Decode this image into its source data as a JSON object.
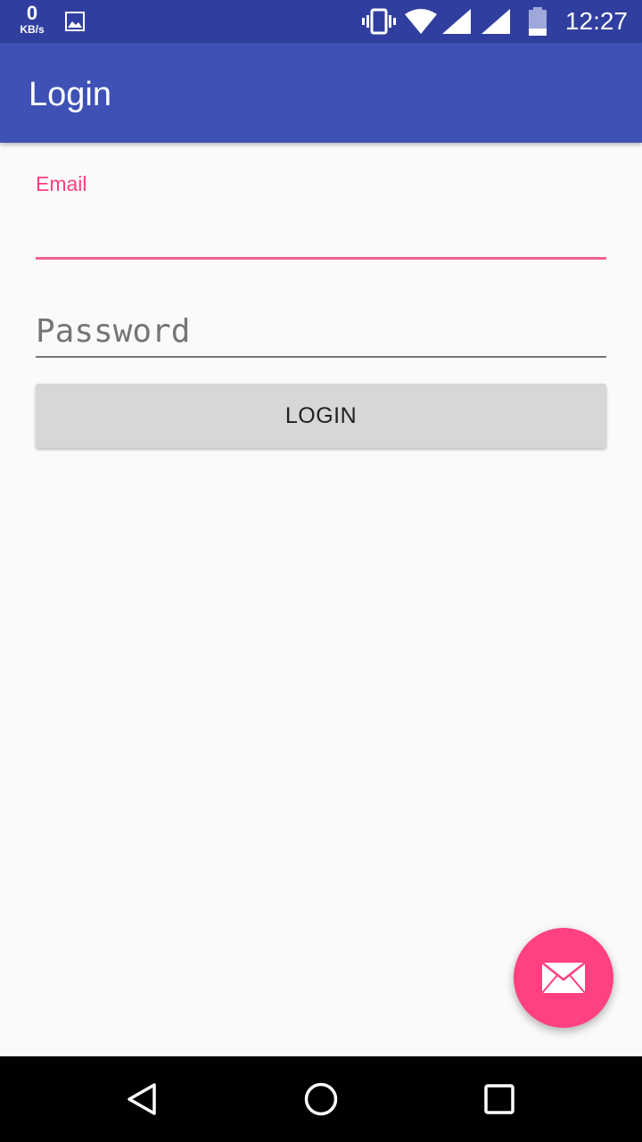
{
  "status_bar": {
    "net_speed_value": "0",
    "net_speed_unit": "KB/s",
    "time": "12:27",
    "icons": [
      "image-notification-icon",
      "vibrate-icon",
      "wifi-icon",
      "signal-icon",
      "signal-icon-2",
      "battery-icon"
    ]
  },
  "app_bar": {
    "title": "Login"
  },
  "form": {
    "email_label": "Email",
    "email_value": "",
    "password_placeholder": "Password",
    "login_button_label": "LOGIN"
  },
  "fab": {
    "icon": "email-icon"
  },
  "nav_bar": {
    "icons": [
      "back-icon",
      "home-icon",
      "recents-icon"
    ]
  },
  "colors": {
    "status_bar": "#303f9f",
    "primary": "#3f51b5",
    "accent": "#ff4081",
    "background": "#fafafa",
    "button": "#d6d7d7"
  }
}
